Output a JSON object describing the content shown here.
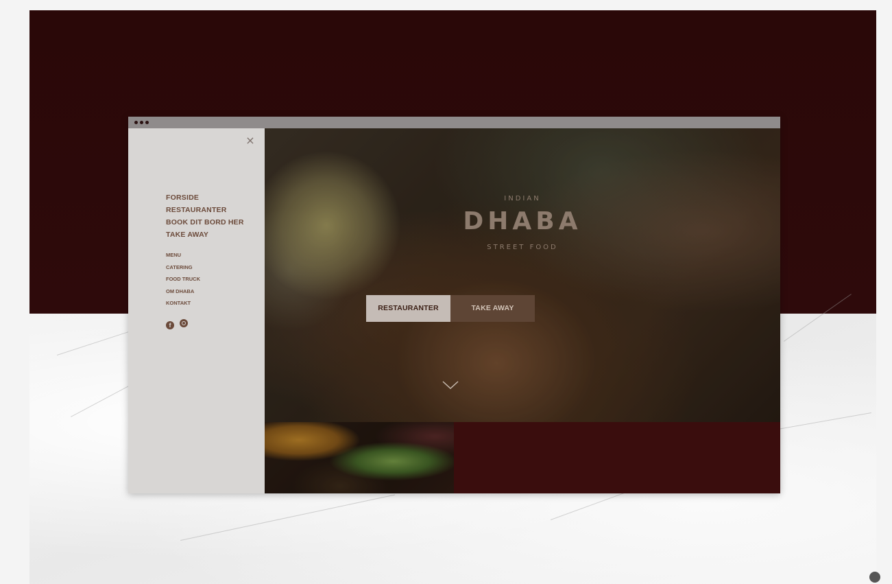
{
  "sidebar": {
    "close_symbol": "×",
    "main_nav": [
      {
        "label": "FORSIDE"
      },
      {
        "label": "RESTAURANTER"
      },
      {
        "label": "BOOK DIT BORD HER"
      },
      {
        "label": "TAKE AWAY"
      }
    ],
    "secondary_nav": [
      {
        "label": "MENU"
      },
      {
        "label": "CATERING"
      },
      {
        "label": "FOOD TRUCK"
      },
      {
        "label": "OM DHABA"
      },
      {
        "label": "KONTAKT"
      }
    ],
    "social_icons": [
      "facebook-icon",
      "instagram-icon"
    ]
  },
  "hero": {
    "logo_top": "INDIAN",
    "logo_main": "DHABA",
    "logo_bottom": "STREET FOOD",
    "primary_button": "RESTAURANTER",
    "secondary_button": "TAKE AWAY"
  },
  "colors": {
    "maroon": "#2e0a0b",
    "sidebar_bg": "#d8d6d4",
    "nav_text": "#6b4a3a",
    "button_light": "#c5bcb6",
    "button_dark": "#5e4535"
  }
}
